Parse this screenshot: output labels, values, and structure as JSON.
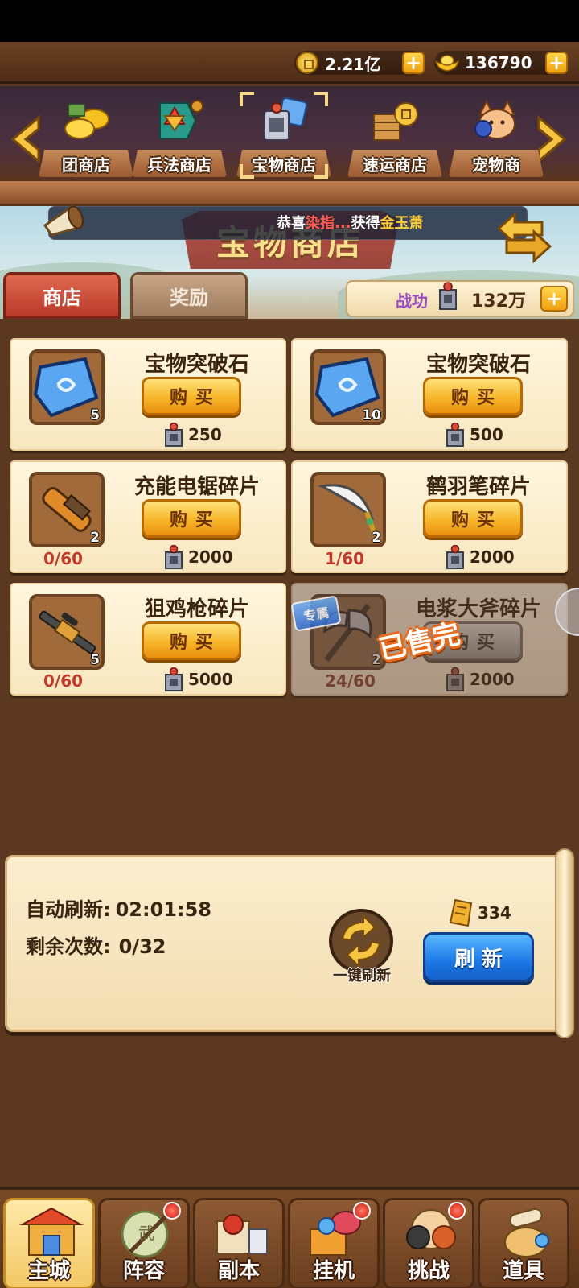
{
  "currencies": {
    "copper": {
      "value": "2.21亿",
      "icon": "copper-coin-icon"
    },
    "gold_ingot": {
      "value": "136790",
      "icon": "gold-ingot-icon"
    }
  },
  "shop_tabs": [
    {
      "label": "团商店",
      "icon": "gold-ingot-pile-icon"
    },
    {
      "label": "兵法商店",
      "icon": "war-banner-icon"
    },
    {
      "label": "宝物商店",
      "icon": "treasure-lock-icon",
      "selected": true
    },
    {
      "label": "速运商店",
      "icon": "crates-coin-icon"
    },
    {
      "label": "宠物商",
      "icon": "fox-pet-icon"
    }
  ],
  "banner": {
    "title": "宝物商店",
    "announcement": {
      "prefix": "恭喜",
      "player": "染指...",
      "middle": "获得",
      "item": "金玉萧"
    }
  },
  "page_tabs": {
    "shop": "商店",
    "reward": "奖励",
    "active": "shop"
  },
  "merit": {
    "label": "战功",
    "value": "132万"
  },
  "items": [
    {
      "name": "宝物突破石",
      "qty": "5",
      "buy_label": "购买",
      "price": "250",
      "progress": "",
      "icon": "breakthrough-stone-icon",
      "sold_out": false
    },
    {
      "name": "宝物突破石",
      "qty": "10",
      "buy_label": "购买",
      "price": "500",
      "progress": "",
      "icon": "breakthrough-stone-icon",
      "sold_out": false
    },
    {
      "name": "充能电锯碎片",
      "qty": "2",
      "buy_label": "购买",
      "price": "2000",
      "progress": "0/60",
      "icon": "chainsaw-icon",
      "sold_out": false
    },
    {
      "name": "鹤羽笔碎片",
      "qty": "2",
      "buy_label": "购买",
      "price": "2000",
      "progress": "1/60",
      "icon": "feather-pen-icon",
      "sold_out": false
    },
    {
      "name": "狙鸡枪碎片",
      "qty": "5",
      "buy_label": "购买",
      "price": "5000",
      "progress": "0/60",
      "icon": "sniper-rifle-icon",
      "sold_out": false
    },
    {
      "name": "电浆大斧碎片",
      "qty": "2",
      "buy_label": "购买",
      "price": "2000",
      "progress": "24/60",
      "icon": "plasma-axe-icon",
      "sold_out": true,
      "tag": "专属",
      "sold_label": "已售完"
    }
  ],
  "refresh": {
    "auto_label": "自动刷新:",
    "auto_time": "02:01:58",
    "remaining_label": "剩余次数:",
    "remaining_value": "0/32",
    "one_key_label": "一键刷新",
    "cost": "334",
    "button_label": "刷新"
  },
  "bottom_nav": [
    {
      "label": "主城",
      "icon": "city-gate-icon",
      "active": true,
      "badge": false
    },
    {
      "label": "阵容",
      "icon": "formation-icon",
      "active": false,
      "badge": true
    },
    {
      "label": "副本",
      "icon": "dungeon-icon",
      "active": false,
      "badge": false
    },
    {
      "label": "挂机",
      "icon": "idle-treasure-icon",
      "active": false,
      "badge": true
    },
    {
      "label": "挑战",
      "icon": "challenge-icon",
      "active": false,
      "badge": true
    },
    {
      "label": "道具",
      "icon": "items-bag-icon",
      "active": false,
      "badge": false
    }
  ],
  "colors": {
    "accent_gold": "#f7b62a",
    "refresh_blue": "#1c78e6",
    "progress_red": "#c0392b",
    "merit_purple": "#9b4ec4"
  }
}
